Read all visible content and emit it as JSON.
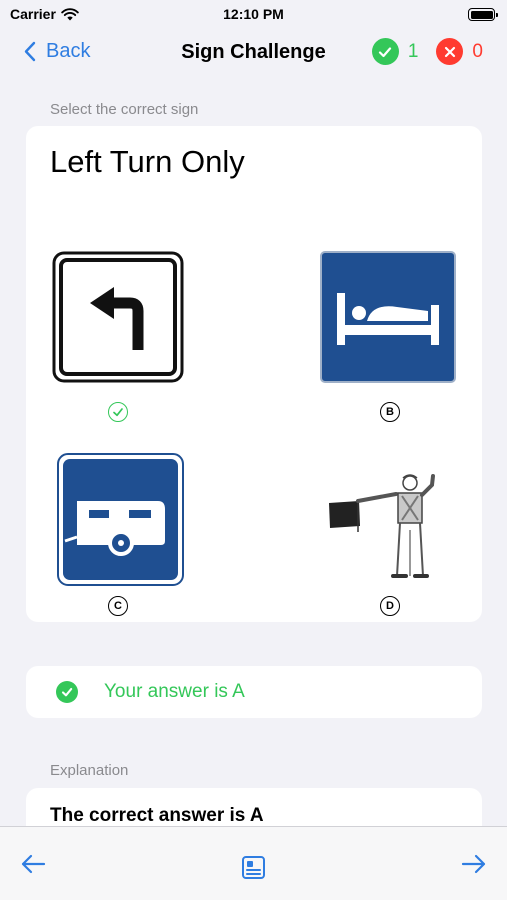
{
  "status_bar": {
    "carrier": "Carrier",
    "time": "12:10 PM"
  },
  "nav": {
    "back_label": "Back",
    "title": "Sign Challenge",
    "correct_count": "1",
    "wrong_count": "0"
  },
  "prompt": "Select the correct sign",
  "question": "Left Turn Only",
  "options": [
    {
      "letter": "A",
      "sign": "left-turn-arrow-sign",
      "selected_correct": true
    },
    {
      "letter": "B",
      "sign": "lodging-bed-sign"
    },
    {
      "letter": "C",
      "sign": "camper-trailer-sign"
    },
    {
      "letter": "D",
      "sign": "flagger-with-flag-sign"
    }
  ],
  "result": {
    "text": "Your answer is A"
  },
  "explanation": {
    "label": "Explanation",
    "text": "The correct answer is A"
  },
  "colors": {
    "accent": "#2f7de1",
    "correct": "#34c759",
    "wrong": "#ff3b30",
    "sign_blue": "#1f4f91"
  },
  "toolbar": {
    "icons": [
      "arrow-left-icon",
      "question-list-icon",
      "arrow-right-icon"
    ]
  }
}
